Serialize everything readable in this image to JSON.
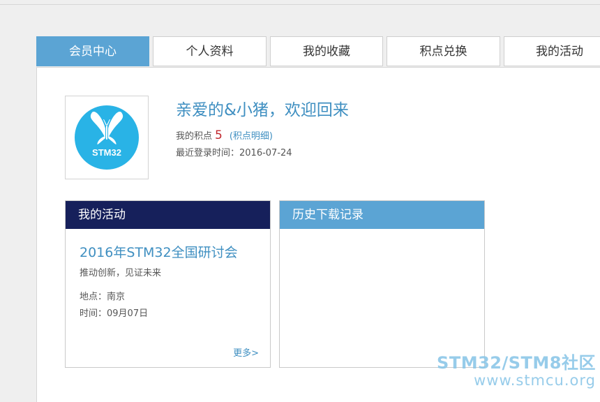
{
  "tabs": [
    {
      "label": "会员中心",
      "active": true
    },
    {
      "label": "个人资料",
      "active": false
    },
    {
      "label": "我的收藏",
      "active": false
    },
    {
      "label": "积点兑换",
      "active": false
    },
    {
      "label": "我的活动",
      "active": false
    }
  ],
  "profile": {
    "avatar_text": "STM32",
    "avatar_icon": "butterfly-logo",
    "welcome": "亲爱的&小猪，欢迎回来",
    "points_label": "我的积点",
    "points_value": "5",
    "points_detail_link": "(积点明细)",
    "last_login": "最近登录时间：2016-07-24"
  },
  "activity_card": {
    "title": "我的活动",
    "event_title": "2016年STM32全国研讨会",
    "event_subtitle": "推动创新，见证未来",
    "location": "地点：南京",
    "time": "时间：09月07日",
    "more_link": "更多>"
  },
  "download_card": {
    "title": "历史下载记录"
  },
  "watermark": {
    "brand": "STM32/STM8社区",
    "url": "www.stmcu.org"
  },
  "colors": {
    "accent_blue": "#5ba4d4",
    "navy": "#16205b",
    "link_blue": "#3f8fc1",
    "points_red": "#c0272d",
    "logo_blue": "#29b3e6"
  }
}
